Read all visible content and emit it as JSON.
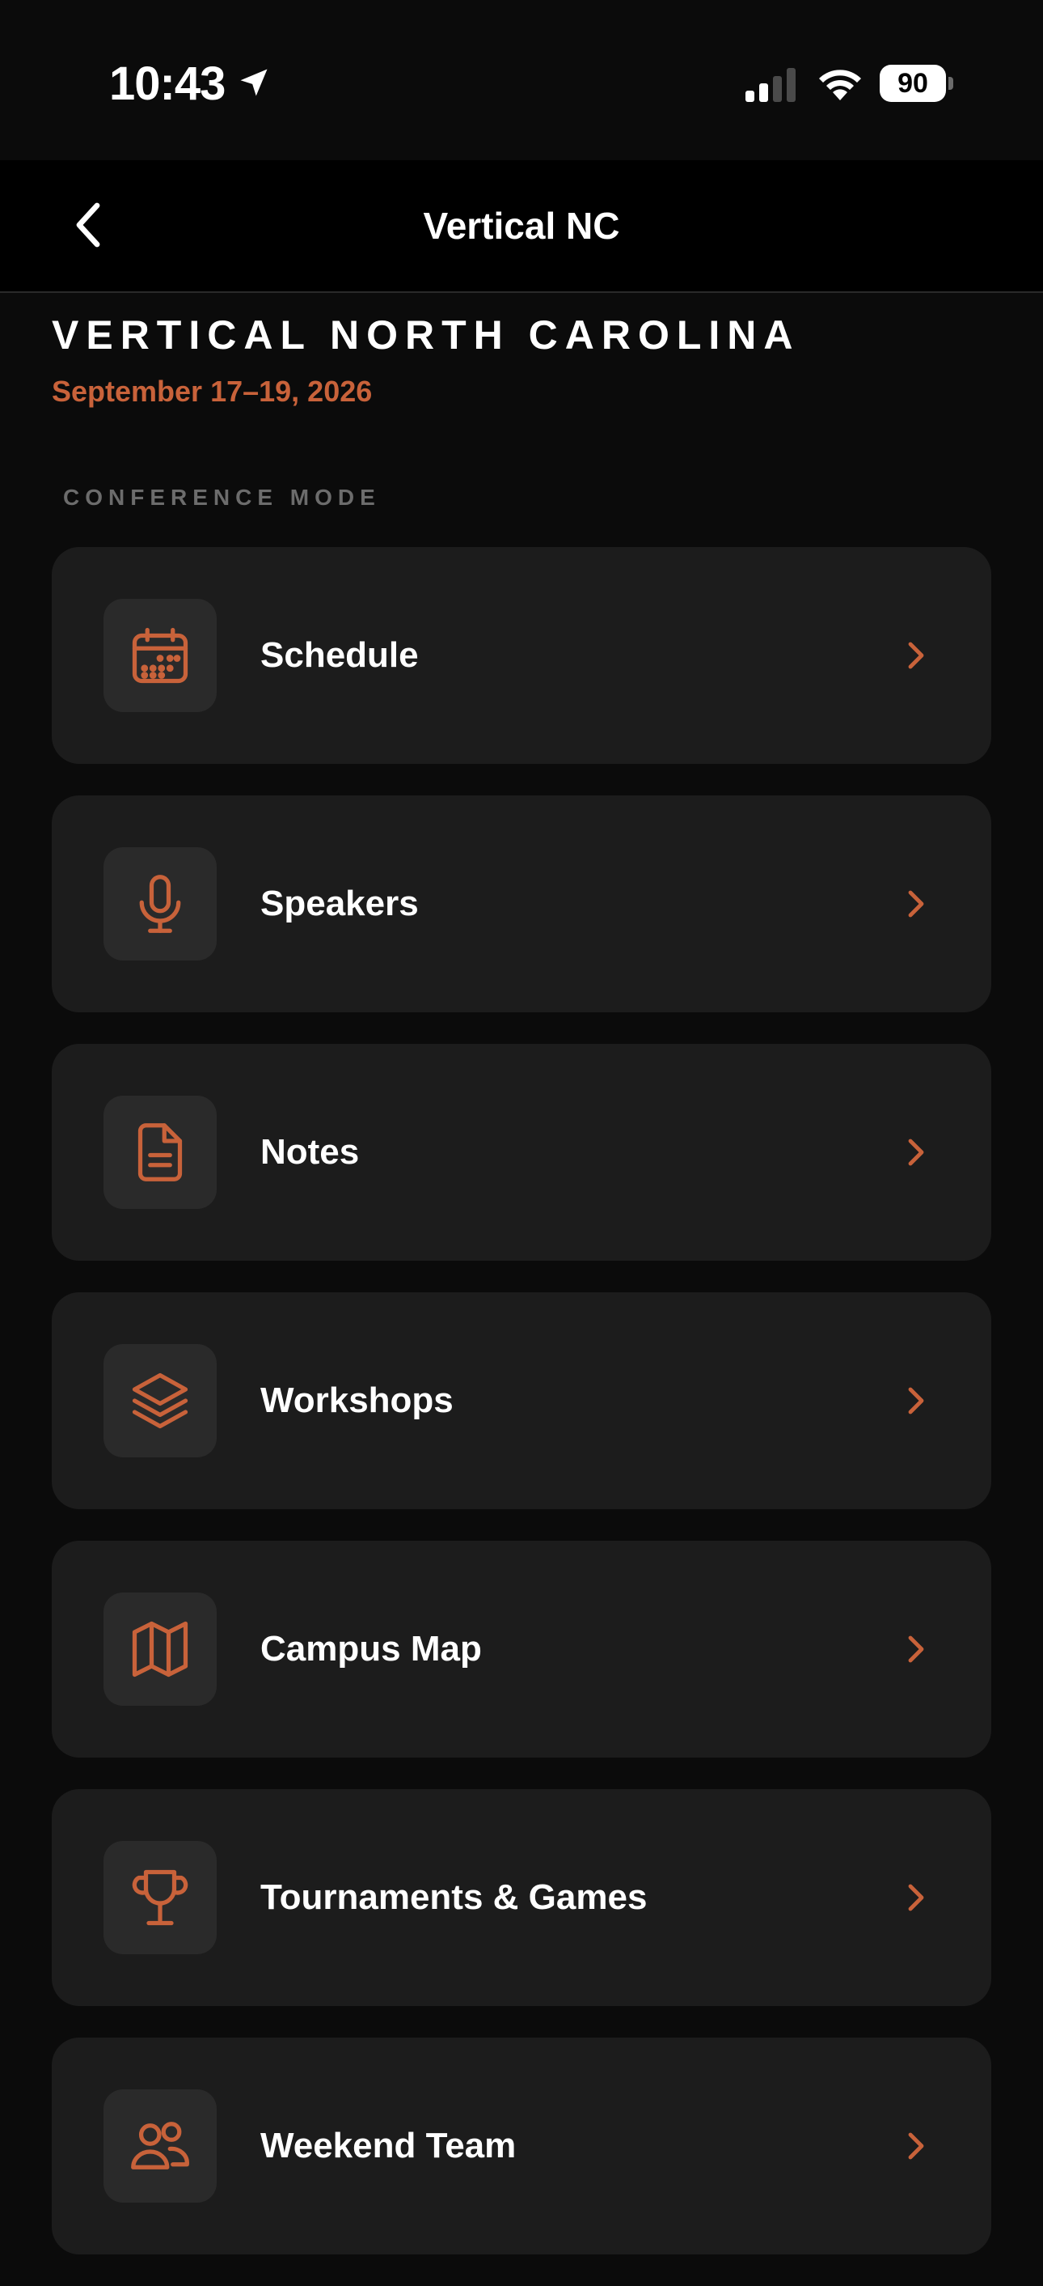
{
  "status_bar": {
    "time": "10:43",
    "battery_level": "90",
    "icons": [
      "location-arrow-icon",
      "cellular-signal-icon",
      "wifi-icon",
      "battery-icon"
    ]
  },
  "nav": {
    "title": "Vertical NC",
    "back_icon": "chevron-left-icon"
  },
  "header": {
    "title": "VERTICAL NORTH CAROLINA",
    "dates": "September 17–19, 2026"
  },
  "section": {
    "label": "CONFERENCE MODE"
  },
  "menu": {
    "items": [
      {
        "label": "Schedule",
        "icon": "calendar-icon"
      },
      {
        "label": "Speakers",
        "icon": "microphone-icon"
      },
      {
        "label": "Notes",
        "icon": "document-icon"
      },
      {
        "label": "Workshops",
        "icon": "layers-icon"
      },
      {
        "label": "Campus Map",
        "icon": "map-icon"
      },
      {
        "label": "Tournaments & Games",
        "icon": "trophy-icon"
      },
      {
        "label": "Weekend Team",
        "icon": "users-icon"
      }
    ]
  },
  "colors": {
    "background": "#0b0b0b",
    "nav_background": "#000000",
    "card_background": "#1c1c1c",
    "icon_tile_background": "#2a2a2a",
    "accent": "#c8623a",
    "section_label": "#6c6c6c",
    "text": "#ffffff"
  }
}
